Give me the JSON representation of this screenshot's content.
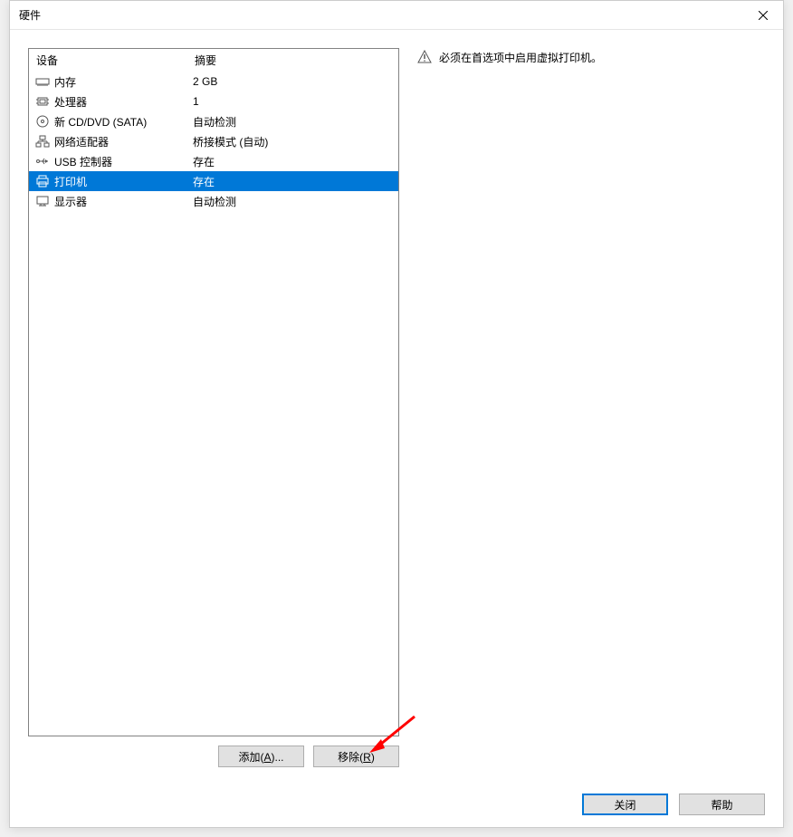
{
  "titlebar": {
    "title": "硬件"
  },
  "deviceList": {
    "headers": {
      "device": "设备",
      "summary": "摘要"
    },
    "rows": [
      {
        "icon": "memory",
        "name": "内存",
        "summary": "2 GB",
        "selected": false
      },
      {
        "icon": "cpu",
        "name": "处理器",
        "summary": "1",
        "selected": false
      },
      {
        "icon": "disc",
        "name": "新 CD/DVD (SATA)",
        "summary": "自动检测",
        "selected": false
      },
      {
        "icon": "network",
        "name": "网络适配器",
        "summary": "桥接模式 (自动)",
        "selected": false
      },
      {
        "icon": "usb",
        "name": "USB 控制器",
        "summary": "存在",
        "selected": false
      },
      {
        "icon": "printer",
        "name": "打印机",
        "summary": "存在",
        "selected": true
      },
      {
        "icon": "monitor",
        "name": "显示器",
        "summary": "自动检测",
        "selected": false
      }
    ]
  },
  "buttons": {
    "add": "添加(A)...",
    "remove": "移除(R)",
    "close": "关闭",
    "help": "帮助"
  },
  "warning": {
    "text": "必须在首选项中启用虚拟打印机。"
  }
}
